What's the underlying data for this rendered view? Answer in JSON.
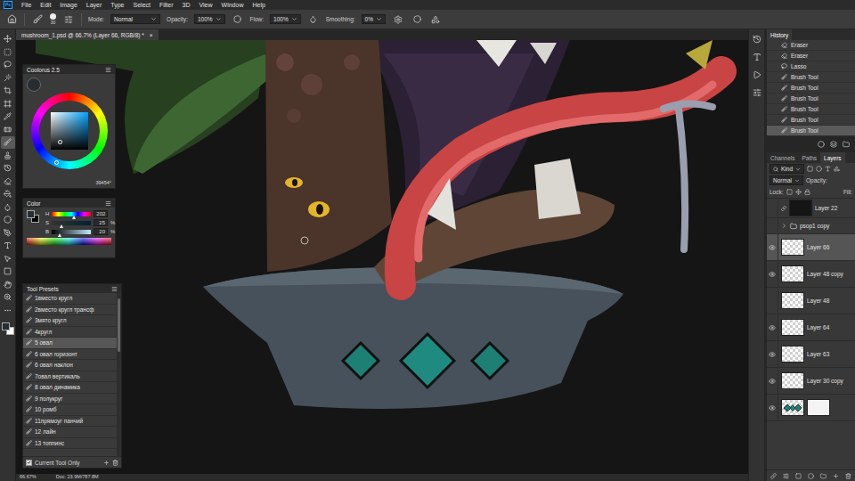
{
  "app": {
    "logo": "Ps",
    "menu": [
      "File",
      "Edit",
      "Image",
      "Layer",
      "Type",
      "Select",
      "Filter",
      "3D",
      "View",
      "Window",
      "Help"
    ]
  },
  "options_bar": {
    "brush_size": "30",
    "mode_label": "Mode:",
    "mode": "Normal",
    "opacity_label": "Opacity:",
    "opacity": "100%",
    "flow_label": "Flow:",
    "flow": "100%",
    "smoothing_label": "Smoothing:",
    "smoothing": "0%"
  },
  "document_tab": {
    "title": "mushroom_1.psd @ 66.7% (Layer 66, RGB/8) *",
    "close": "×"
  },
  "toolbar": {
    "tools": [
      {
        "selected": false
      },
      {
        "selected": false
      },
      {
        "selected": false
      },
      {
        "selected": false
      },
      {
        "selected": false
      },
      {
        "selected": false
      },
      {
        "selected": false
      },
      {
        "selected": false
      },
      {
        "selected": true
      },
      {
        "selected": false
      },
      {
        "selected": false
      },
      {
        "selected": false
      },
      {
        "selected": false
      },
      {
        "selected": false
      },
      {
        "selected": false
      },
      {
        "selected": false
      },
      {
        "selected": false
      },
      {
        "selected": false
      },
      {
        "selected": false
      },
      {
        "selected": false
      },
      {
        "selected": false
      },
      {
        "selected": false
      }
    ]
  },
  "coolorus": {
    "title": "Coolorus 2.5",
    "readout": "39454°"
  },
  "color_panel": {
    "title": "Color",
    "channels": [
      {
        "label": "H",
        "value": "202",
        "unit": "",
        "level": 0.56
      },
      {
        "label": "S",
        "value": "25",
        "unit": "%",
        "level": 0.25
      },
      {
        "label": "B",
        "value": "20",
        "unit": "%",
        "level": 0.2
      }
    ]
  },
  "tool_presets": {
    "title": "Tool Presets",
    "items": [
      {
        "label": "1вместо кругл",
        "selected": false
      },
      {
        "label": "2вместо кругл трансф",
        "selected": false
      },
      {
        "label": "3мято кругл",
        "selected": false
      },
      {
        "label": "4кругл",
        "selected": false
      },
      {
        "label": "5 овал",
        "selected": true
      },
      {
        "label": "6 овал горизонт",
        "selected": false
      },
      {
        "label": "6 овал наклон",
        "selected": false
      },
      {
        "label": "7овал вертикаль",
        "selected": false
      },
      {
        "label": "8 овал динамика",
        "selected": false
      },
      {
        "label": "9 полукруг",
        "selected": false
      },
      {
        "label": "10 ромб",
        "selected": false
      },
      {
        "label": "11прямоуг панчий",
        "selected": false
      },
      {
        "label": "12 лайн",
        "selected": false
      },
      {
        "label": "13 топпинс",
        "selected": false
      }
    ],
    "current_tool_only": {
      "label": "Current Tool Only",
      "checked": true
    }
  },
  "history": {
    "title": "History",
    "items": [
      {
        "label": "Eraser",
        "kind": "eraser",
        "selected": false
      },
      {
        "label": "Eraser",
        "kind": "eraser",
        "selected": false
      },
      {
        "label": "Lasso",
        "kind": "lasso",
        "selected": false
      },
      {
        "label": "Brush Tool",
        "kind": "brush",
        "selected": false
      },
      {
        "label": "Brush Tool",
        "kind": "brush",
        "selected": false
      },
      {
        "label": "Brush Tool",
        "kind": "brush",
        "selected": false
      },
      {
        "label": "Brush Tool",
        "kind": "brush",
        "selected": false
      },
      {
        "label": "Brush Tool",
        "kind": "brush",
        "selected": false
      },
      {
        "label": "Brush Tool",
        "kind": "brush",
        "selected": true
      }
    ]
  },
  "layers_panel": {
    "tabs": [
      {
        "label": "Channels",
        "selected": false
      },
      {
        "label": "Paths",
        "selected": false
      },
      {
        "label": "Layers",
        "selected": true
      }
    ],
    "filter": "Kind",
    "blend_mode": "Normal",
    "opacity_label": "Opacity:",
    "lock_label": "Lock:",
    "fill_label": "Fill:",
    "layers": [
      {
        "name": "Layer 22",
        "kind": "layer",
        "visible": false,
        "selected": false
      },
      {
        "name": "psop1 copy",
        "kind": "group",
        "visible": false,
        "selected": false
      },
      {
        "name": "Layer 66",
        "kind": "layer",
        "visible": true,
        "selected": true
      },
      {
        "name": "Layer 48 copy",
        "kind": "layer",
        "visible": true,
        "selected": false
      },
      {
        "name": "Layer 48",
        "kind": "layer",
        "visible": false,
        "selected": false
      },
      {
        "name": "Layer 64",
        "kind": "layer",
        "visible": true,
        "selected": false
      },
      {
        "name": "Layer 63",
        "kind": "layer",
        "visible": true,
        "selected": false
      },
      {
        "name": "Layer 30 copy",
        "kind": "layer",
        "visible": true,
        "selected": false
      },
      {
        "name": "",
        "kind": "masked",
        "visible": true,
        "selected": false
      }
    ]
  },
  "status_bar": {
    "zoom": "66.67%",
    "doc": "Doc: 23.9M/787.8M"
  }
}
